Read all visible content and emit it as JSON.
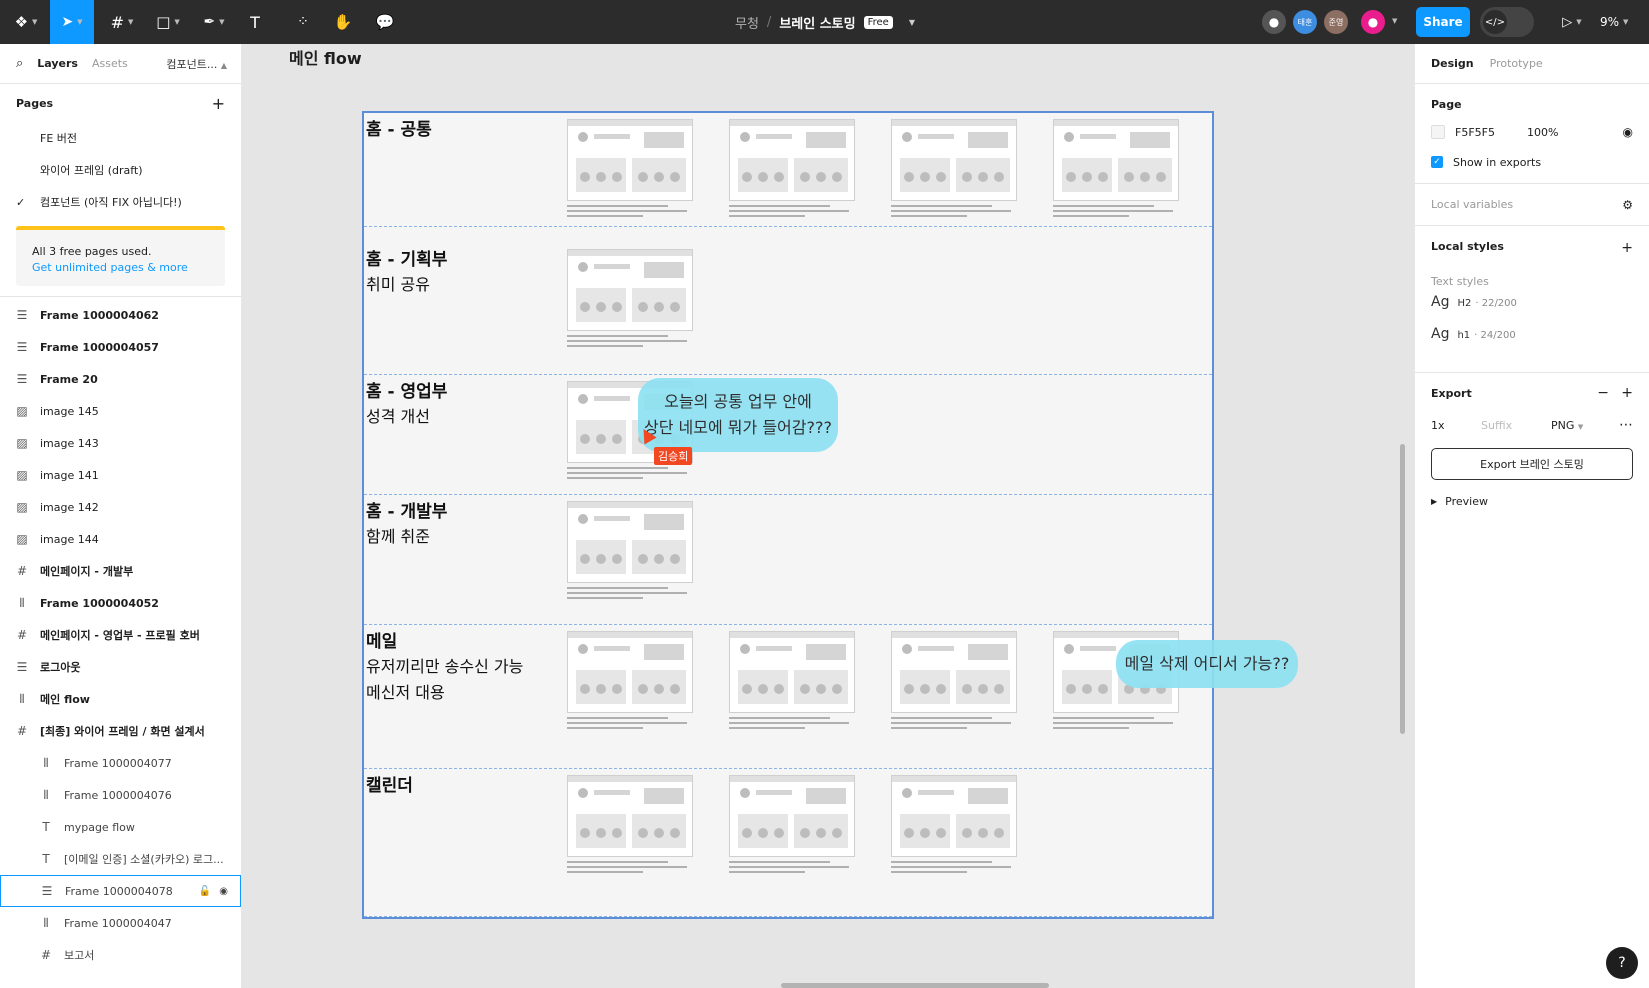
{
  "toolbar": {
    "project": "무청",
    "file_name": "브레인 스토밍",
    "plan_badge": "Free",
    "avatars": [
      {
        "initials": "",
        "color": "#555555"
      },
      {
        "initials": "태훈",
        "color": "#3d8de0"
      },
      {
        "initials": "준영",
        "color": "#8d6e63"
      },
      {
        "initials": "",
        "color": "#e91e8c"
      }
    ],
    "share_label": "Share",
    "dev_mode_glyph": "</>",
    "zoom": "9%"
  },
  "left_panel": {
    "tabs": [
      "Layers",
      "Assets"
    ],
    "current_page_tab": "컴포넌트...",
    "pages_heading": "Pages",
    "pages": [
      {
        "label": "FE 버전",
        "current": false
      },
      {
        "label": "와이어 프레임 (draft)",
        "current": false
      },
      {
        "label": "컴포넌트 (아직 FIX 아닙니다!)",
        "current": true
      }
    ],
    "upgrade": {
      "text": "All 3 free pages used.",
      "link": "Get unlimited pages & more"
    },
    "layers": [
      {
        "name": "Frame 1000004062",
        "icon": "auto-layout-rows-icon",
        "glyph": "☰",
        "bold": true,
        "child": false
      },
      {
        "name": "Frame 1000004057",
        "icon": "auto-layout-rows-icon",
        "glyph": "☰",
        "bold": true,
        "child": false
      },
      {
        "name": "Frame 20",
        "icon": "auto-layout-rows-icon",
        "glyph": "☰",
        "bold": true,
        "child": false
      },
      {
        "name": "image 145",
        "icon": "image-icon",
        "glyph": "▨",
        "bold": false,
        "child": false
      },
      {
        "name": "image 143",
        "icon": "image-icon",
        "glyph": "▨",
        "bold": false,
        "child": false
      },
      {
        "name": "image 141",
        "icon": "image-icon",
        "glyph": "▨",
        "bold": false,
        "child": false
      },
      {
        "name": "image 142",
        "icon": "image-icon",
        "glyph": "▨",
        "bold": false,
        "child": false
      },
      {
        "name": "image 144",
        "icon": "image-icon",
        "glyph": "▨",
        "bold": false,
        "child": false
      },
      {
        "name": "메인페이지 - 개발부",
        "icon": "frame-icon",
        "glyph": "#",
        "bold": true,
        "child": false
      },
      {
        "name": "Frame 1000004052",
        "icon": "auto-layout-columns-icon",
        "glyph": "⦀",
        "bold": true,
        "child": false
      },
      {
        "name": "메인페이지 - 영업부 - 프로필 호버",
        "icon": "frame-icon",
        "glyph": "#",
        "bold": true,
        "child": false
      },
      {
        "name": "로그아웃",
        "icon": "auto-layout-rows-icon",
        "glyph": "☰",
        "bold": true,
        "child": false
      },
      {
        "name": "메인 flow",
        "icon": "auto-layout-columns-icon",
        "glyph": "⦀",
        "bold": true,
        "child": false
      },
      {
        "name": "[최종] 와이어 프레임 / 화면 설계서",
        "icon": "frame-icon",
        "glyph": "#",
        "bold": true,
        "child": false
      },
      {
        "name": "Frame 1000004077",
        "icon": "auto-layout-columns-icon",
        "glyph": "⦀",
        "bold": false,
        "child": true
      },
      {
        "name": "Frame 1000004076",
        "icon": "auto-layout-columns-icon",
        "glyph": "⦀",
        "bold": false,
        "child": true
      },
      {
        "name": "mypage flow",
        "icon": "text-icon",
        "glyph": "T",
        "bold": false,
        "child": true
      },
      {
        "name": "[이메일 인증] 소셜(카카오) 로그...",
        "icon": "text-icon",
        "glyph": "T",
        "bold": false,
        "child": true
      },
      {
        "name": "Frame 1000004078",
        "icon": "auto-layout-rows-icon",
        "glyph": "☰",
        "bold": false,
        "child": true,
        "selected": true
      },
      {
        "name": "Frame 1000004047",
        "icon": "auto-layout-columns-icon",
        "glyph": "⦀",
        "bold": false,
        "child": true
      },
      {
        "name": "보고서",
        "icon": "frame-icon",
        "glyph": "#",
        "bold": false,
        "child": true
      }
    ]
  },
  "canvas": {
    "frame_title": "메인 flow",
    "sections": [
      {
        "title": "홈 - 공통",
        "subtitle": [],
        "thumbs": 4
      },
      {
        "title": "홈 - 기획부",
        "subtitle": [
          "취미 공유"
        ],
        "thumbs": 1
      },
      {
        "title": "홈 - 영업부",
        "subtitle": [
          "성격 개선"
        ],
        "thumbs": 1
      },
      {
        "title": "홈 - 개발부",
        "subtitle": [
          "함께 취준"
        ],
        "thumbs": 1
      },
      {
        "title": "메일",
        "subtitle": [
          "유저끼리만 송수신 가능",
          "메신저 대용"
        ],
        "thumbs": 4
      },
      {
        "title": "캘린더",
        "subtitle": [],
        "thumbs": 3
      }
    ],
    "comments": [
      {
        "lines": [
          "오늘의 공통 업무 안에",
          "상단 네모에 뭐가 들어감???"
        ]
      },
      {
        "lines": [
          "메일 삭제 어디서 가능??"
        ]
      }
    ],
    "cursor_user": "김승희"
  },
  "right_panel": {
    "tabs": [
      "Design",
      "Prototype"
    ],
    "page": {
      "heading": "Page",
      "color_hex": "F5F5F5",
      "opacity": "100%",
      "show_in_exports": "Show in exports"
    },
    "local_variables": "Local variables",
    "local_styles": {
      "heading": "Local styles",
      "subheading": "Text styles",
      "styles": [
        {
          "name": "H2",
          "spec": "· 22/200"
        },
        {
          "name": "h1",
          "spec": "· 24/200"
        }
      ]
    },
    "export": {
      "heading": "Export",
      "scale": "1x",
      "suffix_placeholder": "Suffix",
      "format": "PNG",
      "button": "Export 브레인 스토밍",
      "preview": "Preview"
    }
  },
  "help": "?"
}
